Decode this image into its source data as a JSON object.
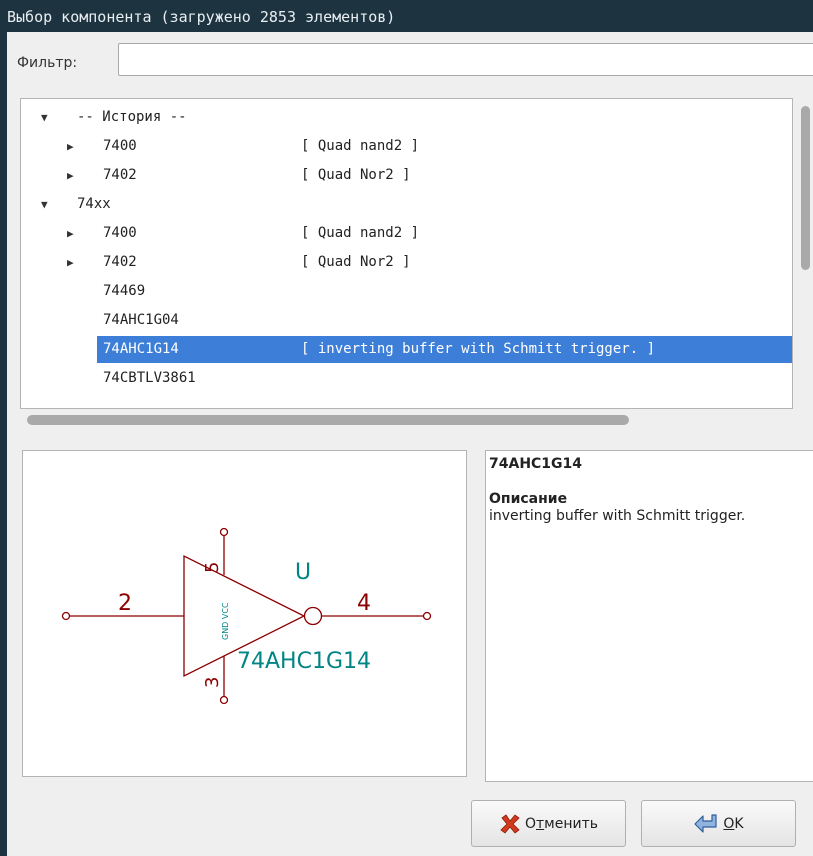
{
  "window": {
    "title": "Выбор компонента (загружено 2853 элементов)"
  },
  "filter": {
    "label": "Фильтр:",
    "value": ""
  },
  "tree": {
    "rows": [
      {
        "arrow": "▼",
        "name": "-- История --",
        "desc": ""
      },
      {
        "arrow": "▶",
        "name": "7400",
        "desc": "[ Quad nand2 ]"
      },
      {
        "arrow": "▶",
        "name": "7402",
        "desc": "[ Quad Nor2 ]"
      },
      {
        "arrow": "▼",
        "name": "74xx",
        "desc": ""
      },
      {
        "arrow": "▶",
        "name": "7400",
        "desc": "[ Quad nand2 ]"
      },
      {
        "arrow": "▶",
        "name": "7402",
        "desc": "[ Quad Nor2 ]"
      },
      {
        "arrow": "",
        "name": "74469",
        "desc": ""
      },
      {
        "arrow": "",
        "name": "74AHC1G04",
        "desc": ""
      },
      {
        "arrow": "",
        "name": "74AHC1G14",
        "desc": "[ inverting buffer with Schmitt trigger. ]",
        "selected": true
      },
      {
        "arrow": "",
        "name": "74CBTLV3861",
        "desc": ""
      }
    ]
  },
  "symbol": {
    "reference": "U",
    "value": "74AHC1G14",
    "pin_in": "2",
    "pin_out": "4",
    "pin_vcc": "5",
    "pin_gnd": "3",
    "power_labels": "GND VCC",
    "color": "#8b0000",
    "text_color": "#008484"
  },
  "info": {
    "name": "74AHC1G14",
    "desc_heading": "Описание",
    "desc_text": "inverting buffer with Schmitt trigger."
  },
  "buttons": {
    "cancel_prefix": "О",
    "cancel_underlined": "т",
    "cancel_rest": "менить",
    "ok_underlined": "О",
    "ok_rest": "K",
    "cancel_icon": "red-x-icon",
    "ok_icon": "enter-arrow-icon"
  }
}
